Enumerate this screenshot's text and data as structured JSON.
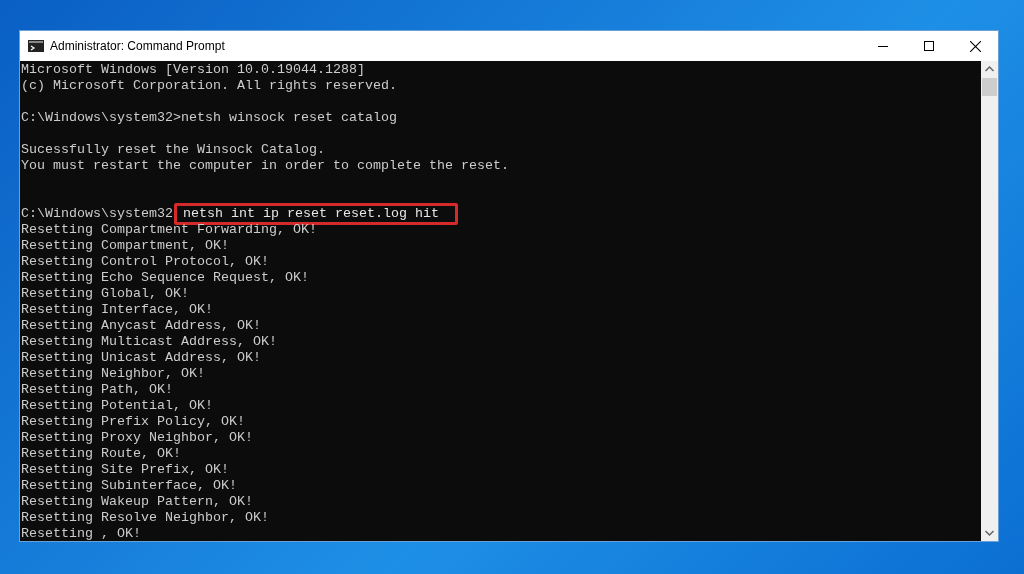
{
  "window": {
    "title": "Administrator: Command Prompt"
  },
  "console": {
    "lines": [
      {
        "kind": "text",
        "text": "Microsoft Windows [Version 10.0.19044.1288]"
      },
      {
        "kind": "text",
        "text": "(c) Microsoft Corporation. All rights reserved."
      },
      {
        "kind": "blank"
      },
      {
        "kind": "text",
        "text": "C:\\Windows\\system32>netsh winsock reset catalog"
      },
      {
        "kind": "blank"
      },
      {
        "kind": "text",
        "text": "Sucessfully reset the Winsock Catalog."
      },
      {
        "kind": "text",
        "text": "You must restart the computer in order to complete the reset."
      },
      {
        "kind": "blank"
      },
      {
        "kind": "blank"
      },
      {
        "kind": "highlighted",
        "prompt": "C:\\Windows\\system32",
        "command": "netsh int ip reset reset.log hit"
      },
      {
        "kind": "text",
        "text": "Resetting Compartment Forwarding, OK!"
      },
      {
        "kind": "text",
        "text": "Resetting Compartment, OK!"
      },
      {
        "kind": "text",
        "text": "Resetting Control Protocol, OK!"
      },
      {
        "kind": "text",
        "text": "Resetting Echo Sequence Request, OK!"
      },
      {
        "kind": "text",
        "text": "Resetting Global, OK!"
      },
      {
        "kind": "text",
        "text": "Resetting Interface, OK!"
      },
      {
        "kind": "text",
        "text": "Resetting Anycast Address, OK!"
      },
      {
        "kind": "text",
        "text": "Resetting Multicast Address, OK!"
      },
      {
        "kind": "text",
        "text": "Resetting Unicast Address, OK!"
      },
      {
        "kind": "text",
        "text": "Resetting Neighbor, OK!"
      },
      {
        "kind": "text",
        "text": "Resetting Path, OK!"
      },
      {
        "kind": "text",
        "text": "Resetting Potential, OK!"
      },
      {
        "kind": "text",
        "text": "Resetting Prefix Policy, OK!"
      },
      {
        "kind": "text",
        "text": "Resetting Proxy Neighbor, OK!"
      },
      {
        "kind": "text",
        "text": "Resetting Route, OK!"
      },
      {
        "kind": "text",
        "text": "Resetting Site Prefix, OK!"
      },
      {
        "kind": "text",
        "text": "Resetting Subinterface, OK!"
      },
      {
        "kind": "text",
        "text": "Resetting Wakeup Pattern, OK!"
      },
      {
        "kind": "text",
        "text": "Resetting Resolve Neighbor, OK!"
      },
      {
        "kind": "text",
        "text": "Resetting , OK!"
      }
    ]
  }
}
